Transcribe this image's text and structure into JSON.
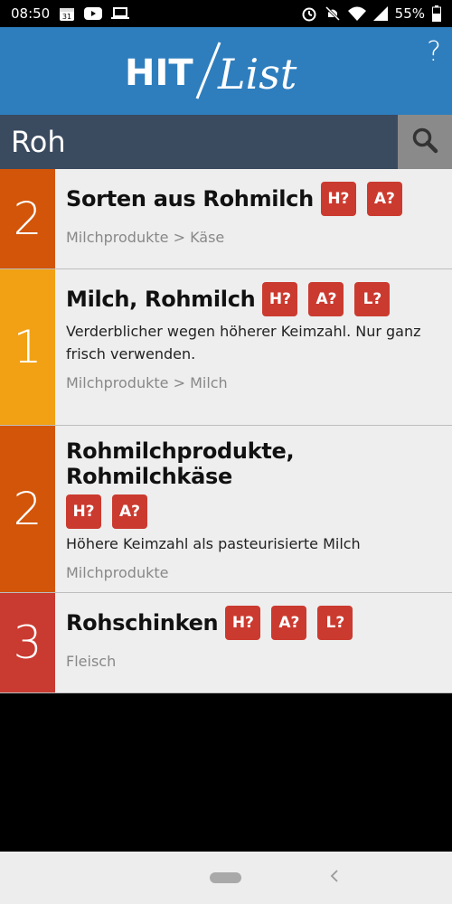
{
  "status_bar": {
    "time": "08:50",
    "calendar_day": "31",
    "battery": "55%"
  },
  "header": {
    "logo_left": "HIT",
    "logo_right": "List",
    "help": "?"
  },
  "search": {
    "value": "Roh"
  },
  "colors": {
    "header": "#2E7EBE",
    "score_2": "#D25509",
    "score_1": "#F2A114",
    "score_3": "#C93A30",
    "badge": "#CB3A2F"
  },
  "items": [
    {
      "score": "2",
      "title": "Sorten aus Rohmilch",
      "badges": [
        "H?",
        "A?"
      ],
      "description": "",
      "category": "Milchprodukte > Käse"
    },
    {
      "score": "1",
      "title": "Milch, Rohmilch",
      "badges": [
        "H?",
        "A?",
        "L?"
      ],
      "description": "Verderblicher wegen höherer Keimzahl. Nur ganz frisch verwenden.",
      "category": "Milchprodukte > Milch"
    },
    {
      "score": "2",
      "title": "Rohmilchprodukte, Rohmilchkäse",
      "badges": [
        "H?",
        "A?"
      ],
      "description": "Höhere Keimzahl als pasteurisierte Milch",
      "category": "Milchprodukte"
    },
    {
      "score": "3",
      "title": "Rohschinken",
      "badges": [
        "H?",
        "A?",
        "L?"
      ],
      "description": "",
      "category": "Fleisch"
    }
  ]
}
